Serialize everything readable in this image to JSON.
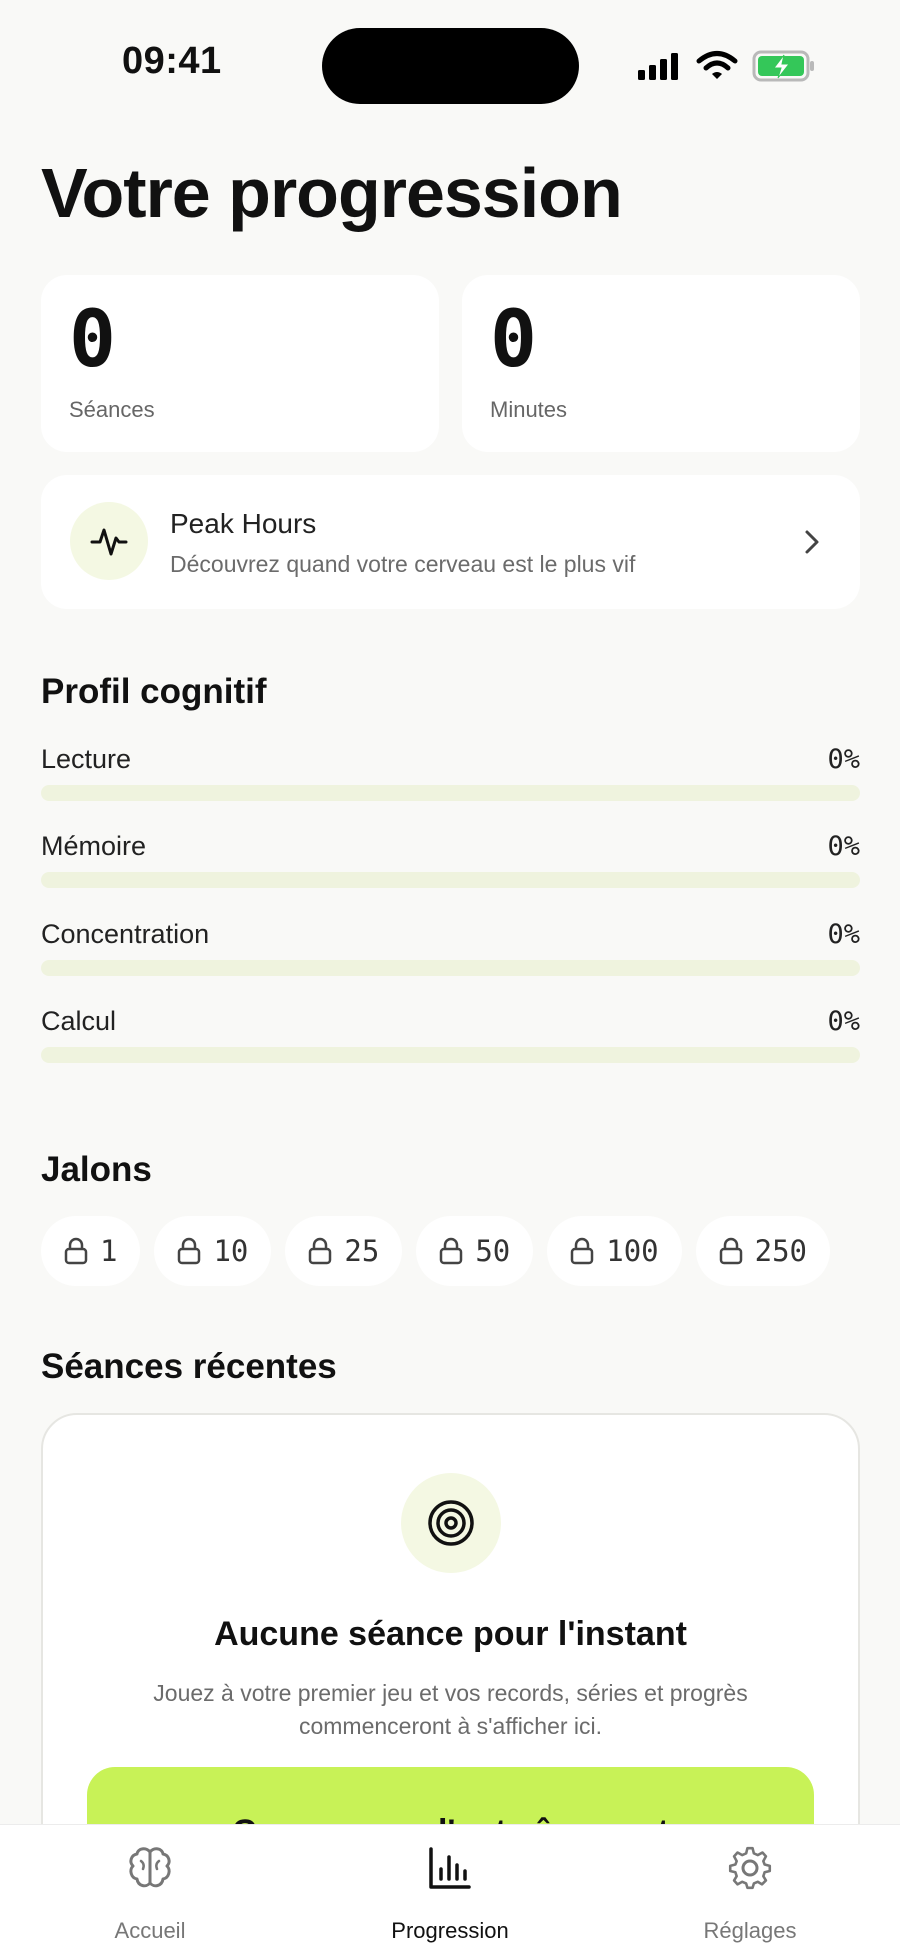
{
  "status_bar": {
    "time": "09:41"
  },
  "page_title": "Votre progression",
  "stats": [
    {
      "value": "0",
      "label": "Séances"
    },
    {
      "value": "0",
      "label": "Minutes"
    }
  ],
  "peak_hours": {
    "title": "Peak Hours",
    "subtitle": "Découvrez quand votre cerveau est le plus vif",
    "icon": "pulse-icon"
  },
  "cognitive_profile": {
    "heading": "Profil cognitif",
    "skills": [
      {
        "name": "Lecture",
        "percent_label": "0%",
        "value": 0
      },
      {
        "name": "Mémoire",
        "percent_label": "0%",
        "value": 0
      },
      {
        "name": "Concentration",
        "percent_label": "0%",
        "value": 0
      },
      {
        "name": "Calcul",
        "percent_label": "0%",
        "value": 0
      }
    ]
  },
  "milestones": {
    "heading": "Jalons",
    "items": [
      "1",
      "10",
      "25",
      "50",
      "100",
      "250"
    ],
    "icon": "lock-icon"
  },
  "recent_sessions": {
    "heading": "Séances récentes",
    "empty_title": "Aucune séance pour l'instant",
    "empty_text": "Jouez à votre premier jeu et vos records, séries et progrès commenceront à s'afficher ici.",
    "cta_label": "Commencer l'entraînement"
  },
  "tabs": [
    {
      "label": "Accueil",
      "icon": "brain-icon",
      "active": false
    },
    {
      "label": "Progression",
      "icon": "bar-chart-icon",
      "active": true
    },
    {
      "label": "Réglages",
      "icon": "gear-icon",
      "active": false
    }
  ],
  "colors": {
    "accent": "#c8f257",
    "track": "#eff3de",
    "background": "#f9f9f7",
    "battery": "#34c759"
  }
}
